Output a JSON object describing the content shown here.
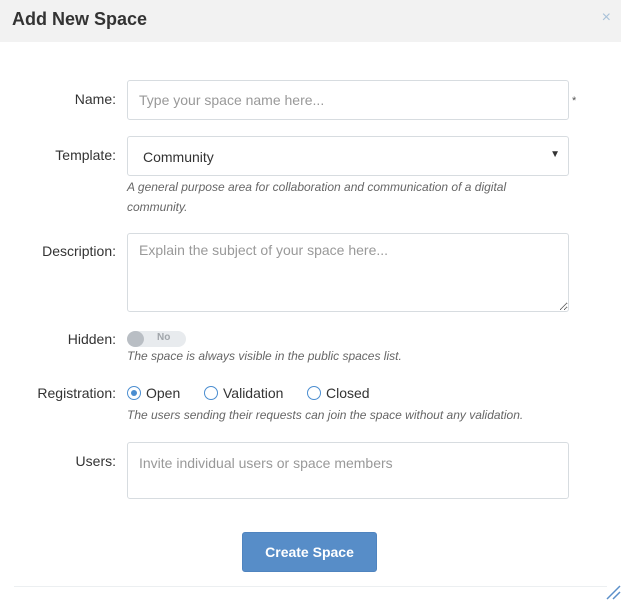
{
  "modal": {
    "title": "Add New Space",
    "close_glyph": "×"
  },
  "form": {
    "name": {
      "label": "Name:",
      "placeholder": "Type your space name here...",
      "value": "",
      "required_mark": "*"
    },
    "template": {
      "label": "Template:",
      "selected": "Community",
      "help": "A general purpose area for collaboration and communication of a digital community."
    },
    "description": {
      "label": "Description:",
      "placeholder": "Explain the subject of your space here...",
      "value": ""
    },
    "hidden": {
      "label": "Hidden:",
      "toggle_text": "No",
      "help": "The space is always visible in the public spaces list."
    },
    "registration": {
      "label": "Registration:",
      "options": [
        {
          "label": "Open",
          "checked": true
        },
        {
          "label": "Validation",
          "checked": false
        },
        {
          "label": "Closed",
          "checked": false
        }
      ],
      "help": "The users sending their requests can join the space without any validation."
    },
    "users": {
      "label": "Users:",
      "placeholder": "Invite individual users or space members",
      "value": ""
    }
  },
  "actions": {
    "create_label": "Create Space"
  },
  "icons": {
    "close": "close-icon",
    "select_arrow": "caret-down-icon",
    "resize": "resize-grip-icon"
  },
  "colors": {
    "accent": "#578dc8",
    "radio": "#4a8dd0",
    "header_bg": "#f2f2f2"
  }
}
